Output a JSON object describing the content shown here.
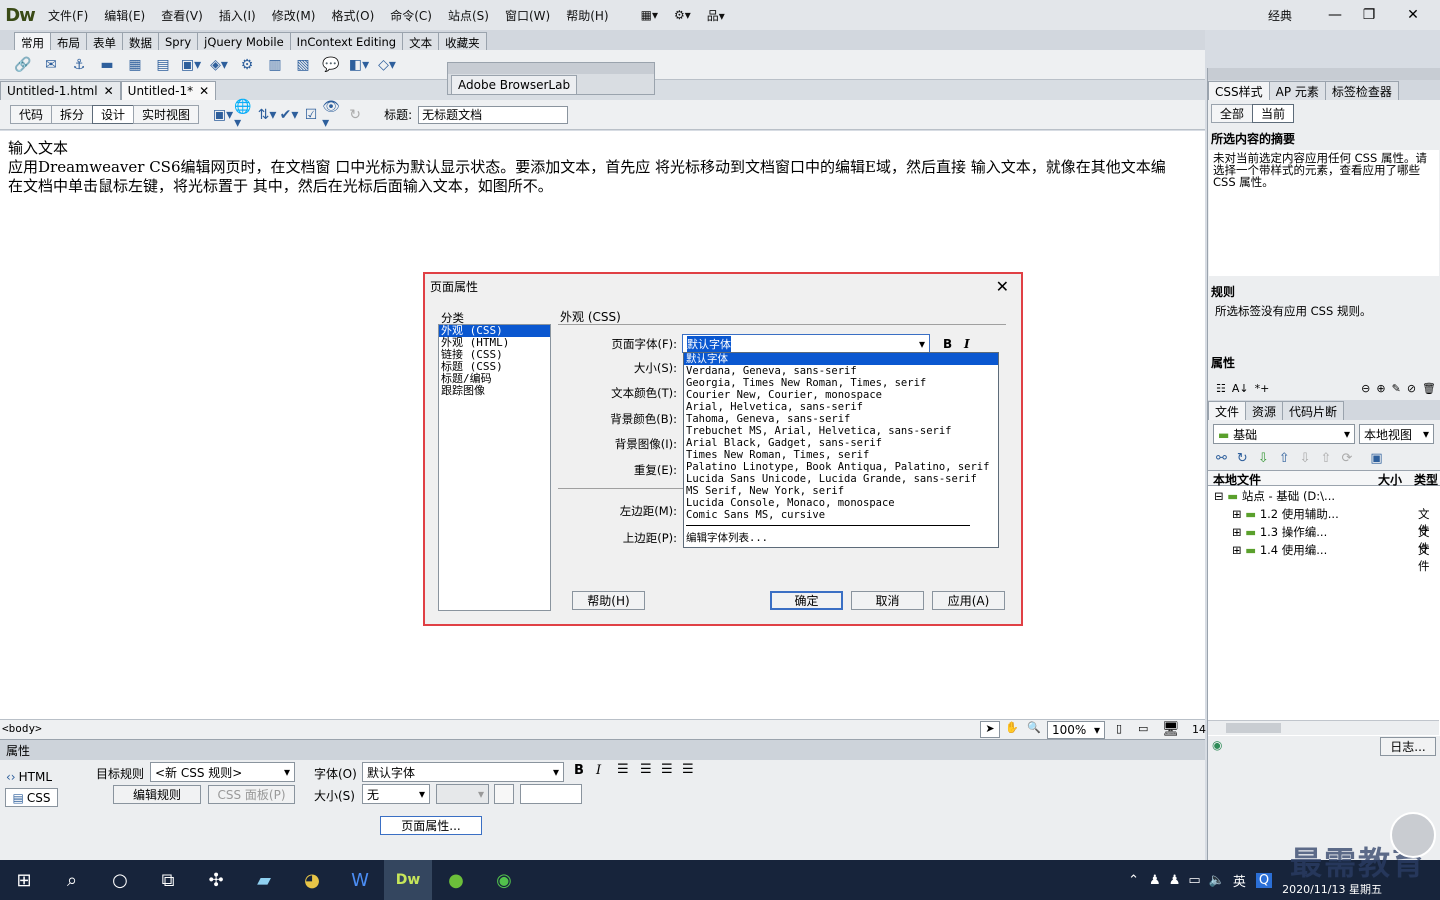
{
  "app": {
    "logo": "Dw",
    "menus": [
      "文件(F)",
      "编辑(E)",
      "查看(V)",
      "插入(I)",
      "修改(M)",
      "格式(O)",
      "命令(C)",
      "站点(S)",
      "窗口(W)",
      "帮助(H)"
    ],
    "workspace": "经典",
    "window_buttons": [
      "—",
      "❐",
      "✕"
    ]
  },
  "insert_tabs": [
    "常用",
    "布局",
    "表单",
    "数据",
    "Spry",
    "jQuery Mobile",
    "InContext Editing",
    "文本",
    "收藏夹"
  ],
  "browserlab": {
    "tab": "Adobe BrowserLab"
  },
  "doc_tabs": [
    {
      "name": "Untitled-1.html"
    },
    {
      "name": "Untitled-1*"
    }
  ],
  "doc_toolbar": {
    "views": [
      "代码",
      "拆分",
      "设计",
      "实时视图"
    ],
    "title_label": "标题:",
    "title_value": "无标题文档"
  },
  "document": {
    "text": "输入文本\n应用Dreamweaver CS6编辑网页时，在文档窗 口中光标为默认显示状态。要添加文本，首先应 将光标移动到文档窗口中的编辑E域，然后直接 输入文本，就像在其他文本编\n在文档中单击鼠标左键，将光标置于 其中，然后在光标后面输入文本，如图所不。"
  },
  "statusbar": {
    "tag": "<body>",
    "zoom": "100%",
    "width": "14"
  },
  "properties": {
    "title": "属性",
    "html_btn": "HTML",
    "css_btn": "CSS",
    "target_rule_label": "目标规则",
    "target_rule_value": "<新 CSS 规则>",
    "edit_rule": "编辑规则",
    "css_panel": "CSS 面板(P)",
    "font_label": "字体(O)",
    "font_value": "默认字体",
    "size_label": "大小(S)",
    "size_value": "无",
    "page_props": "页面属性..."
  },
  "right_panel": {
    "css_tabs": [
      "CSS样式",
      "AP 元素",
      "标签检查器"
    ],
    "subtabs": [
      "全部",
      "当前"
    ],
    "summary_title": "所选内容的摘要",
    "summary_text": "未对当前选定内容应用任何 CSS 属性。请选择一个带样式的元素，查看应用了哪些 CSS 属性。",
    "rules_title": "规则",
    "rules_text": "所选标签没有应用 CSS 规则。",
    "props_title": "属性",
    "file_tabs": [
      "文件",
      "资源",
      "代码片断"
    ],
    "site_name": "基础",
    "view_name": "本地视图",
    "col_local": "本地文件",
    "col_size": "大小",
    "col_type": "类型",
    "tree": [
      {
        "label": "站点 - 基础 (D:\\...",
        "type": ""
      },
      {
        "label": "1.2 使用辅助...",
        "type": "文件"
      },
      {
        "label": "1.3 操作编...",
        "type": "文件"
      },
      {
        "label": "1.4 使用编...",
        "type": "文件"
      }
    ],
    "log_btn": "日志..."
  },
  "dialog": {
    "title": "页面属性",
    "category_label": "分类",
    "categories": [
      "外观 (CSS)",
      "外观 (HTML)",
      "链接 (CSS)",
      "标题 (CSS)",
      "标题/编码",
      "跟踪图像"
    ],
    "section_title": "外观 (CSS)",
    "labels": {
      "font": "页面字体(F):",
      "size": "大小(S):",
      "text_color": "文本颜色(T):",
      "bg_color": "背景颜色(B):",
      "bg_image": "背景图像(I):",
      "repeat": "重复(E):",
      "left_margin": "左边距(M):",
      "top_margin": "上边距(P):"
    },
    "font_value": "默认字体",
    "bold": "B",
    "italic": "I",
    "font_options": [
      "默认字体",
      "Verdana, Geneva, sans-serif",
      "Georgia, Times New Roman, Times, serif",
      "Courier New, Courier, monospace",
      "Arial, Helvetica, sans-serif",
      "Tahoma, Geneva, sans-serif",
      "Trebuchet MS, Arial, Helvetica, sans-serif",
      "Arial Black, Gadget, sans-serif",
      "Times New Roman, Times, serif",
      "Palatino Linotype, Book Antiqua, Palatino, serif",
      "Lucida Sans Unicode, Lucida Grande, sans-serif",
      "MS Serif, New York, serif",
      "Lucida Console, Monaco, monospace",
      "Comic Sans MS, cursive"
    ],
    "edit_font_list": "编辑字体列表...",
    "help": "帮助(H)",
    "ok": "确定",
    "cancel": "取消",
    "apply": "应用(A)"
  },
  "taskbar": {
    "ime": "英",
    "date": "2020/11/13 星期五",
    "watermark": "最需教育"
  }
}
